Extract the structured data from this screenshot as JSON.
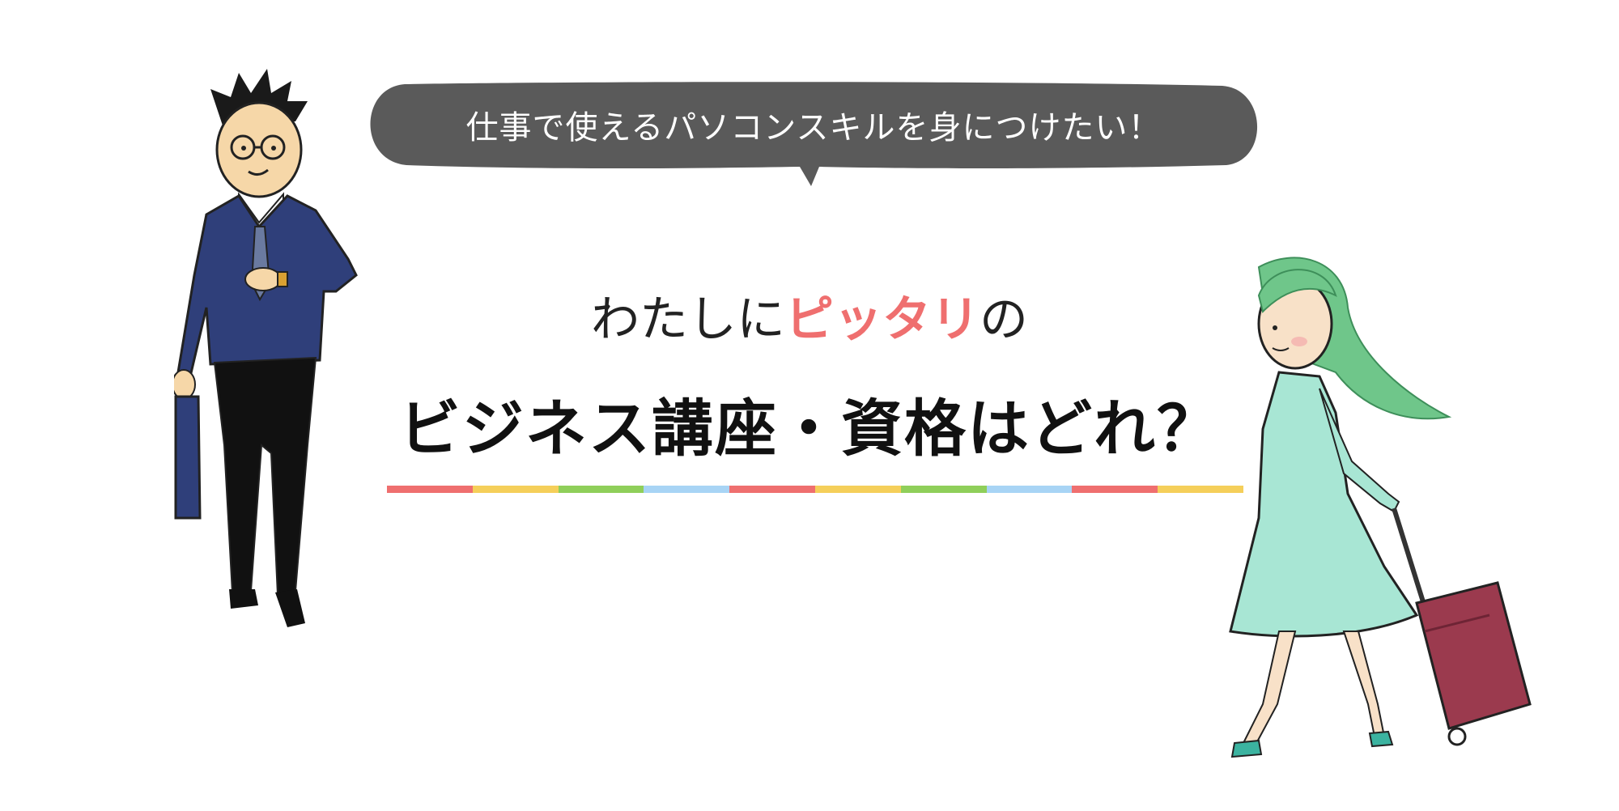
{
  "bubble": {
    "text": "仕事で使えるパソコンスキルを身につけたい！"
  },
  "subtitle": {
    "prefix": "わたしに",
    "accent": "ピッタリ",
    "suffix": "の"
  },
  "headline": "ビジネス講座・資格はどれ？",
  "colors": {
    "bubble": "#5a5a5a",
    "accent": "#ef6f6f",
    "rule": [
      "#ef6f6f",
      "#f5cf5a",
      "#8fcf5a",
      "#a8d4f5",
      "#ef6f6f",
      "#f5cf5a",
      "#8fcf5a",
      "#a8d4f5",
      "#ef6f6f",
      "#f5cf5a"
    ]
  },
  "illustrations": {
    "left": "businessman-checking-watch",
    "right": "woman-walking-with-suitcase"
  }
}
